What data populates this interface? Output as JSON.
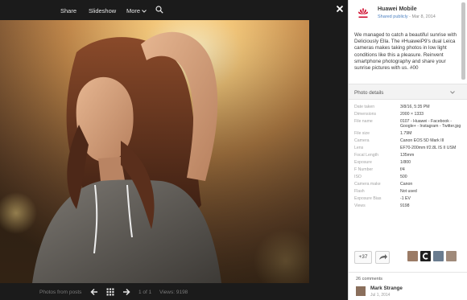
{
  "toolbar": {
    "share": "Share",
    "slideshow": "Slideshow",
    "more": "More"
  },
  "bottom": {
    "source": "Photos from posts",
    "counter": "1 of 1",
    "views": "Views: 9198"
  },
  "post": {
    "author": "Huawei Mobile",
    "shared": "Shared publicly",
    "date": "Mar 8, 2014",
    "text": "We managed to catch a beautiful sunrise with Deliciously Ella. The #HuaweiP9's dual Leica cameras makes taking photos in low light conditions like this a pleasure. Reinvent smartphone photography and share your sunrise pictures with us. #00"
  },
  "photo_details": {
    "header": "Photo details",
    "rows": [
      {
        "k": "Date taken",
        "v": "3/8/16, 5:35 PM"
      },
      {
        "k": "Dimensions",
        "v": "2000 × 1333"
      },
      {
        "k": "File name",
        "v": "0107 - Huawei - Facebook - Google+ - Instagram - Twitter.jpg"
      },
      {
        "k": "File size",
        "v": "1.79M"
      },
      {
        "k": "Camera",
        "v": "Canon EOS 5D Mark III"
      },
      {
        "k": "Lens",
        "v": "EF70-200mm f/2.8L IS II USM"
      },
      {
        "k": "Focal Length",
        "v": "135mm"
      },
      {
        "k": "Exposure",
        "v": "1/800"
      },
      {
        "k": "F Number",
        "v": "f/4"
      },
      {
        "k": "ISO",
        "v": "500"
      },
      {
        "k": "Camera make",
        "v": "Canon"
      },
      {
        "k": "Flash",
        "v": "Not used"
      },
      {
        "k": "Exposure Bias",
        "v": "-1 EV"
      },
      {
        "k": "Views",
        "v": "9198"
      }
    ]
  },
  "actions": {
    "plus_count": "+37"
  },
  "comments": {
    "count_label": "26 comments",
    "first": {
      "name": "Mark Strange",
      "date": "Jul 1, 2014"
    }
  },
  "colors": {
    "link": "#4a7fc0",
    "brand_red": "#cf0a2c"
  }
}
